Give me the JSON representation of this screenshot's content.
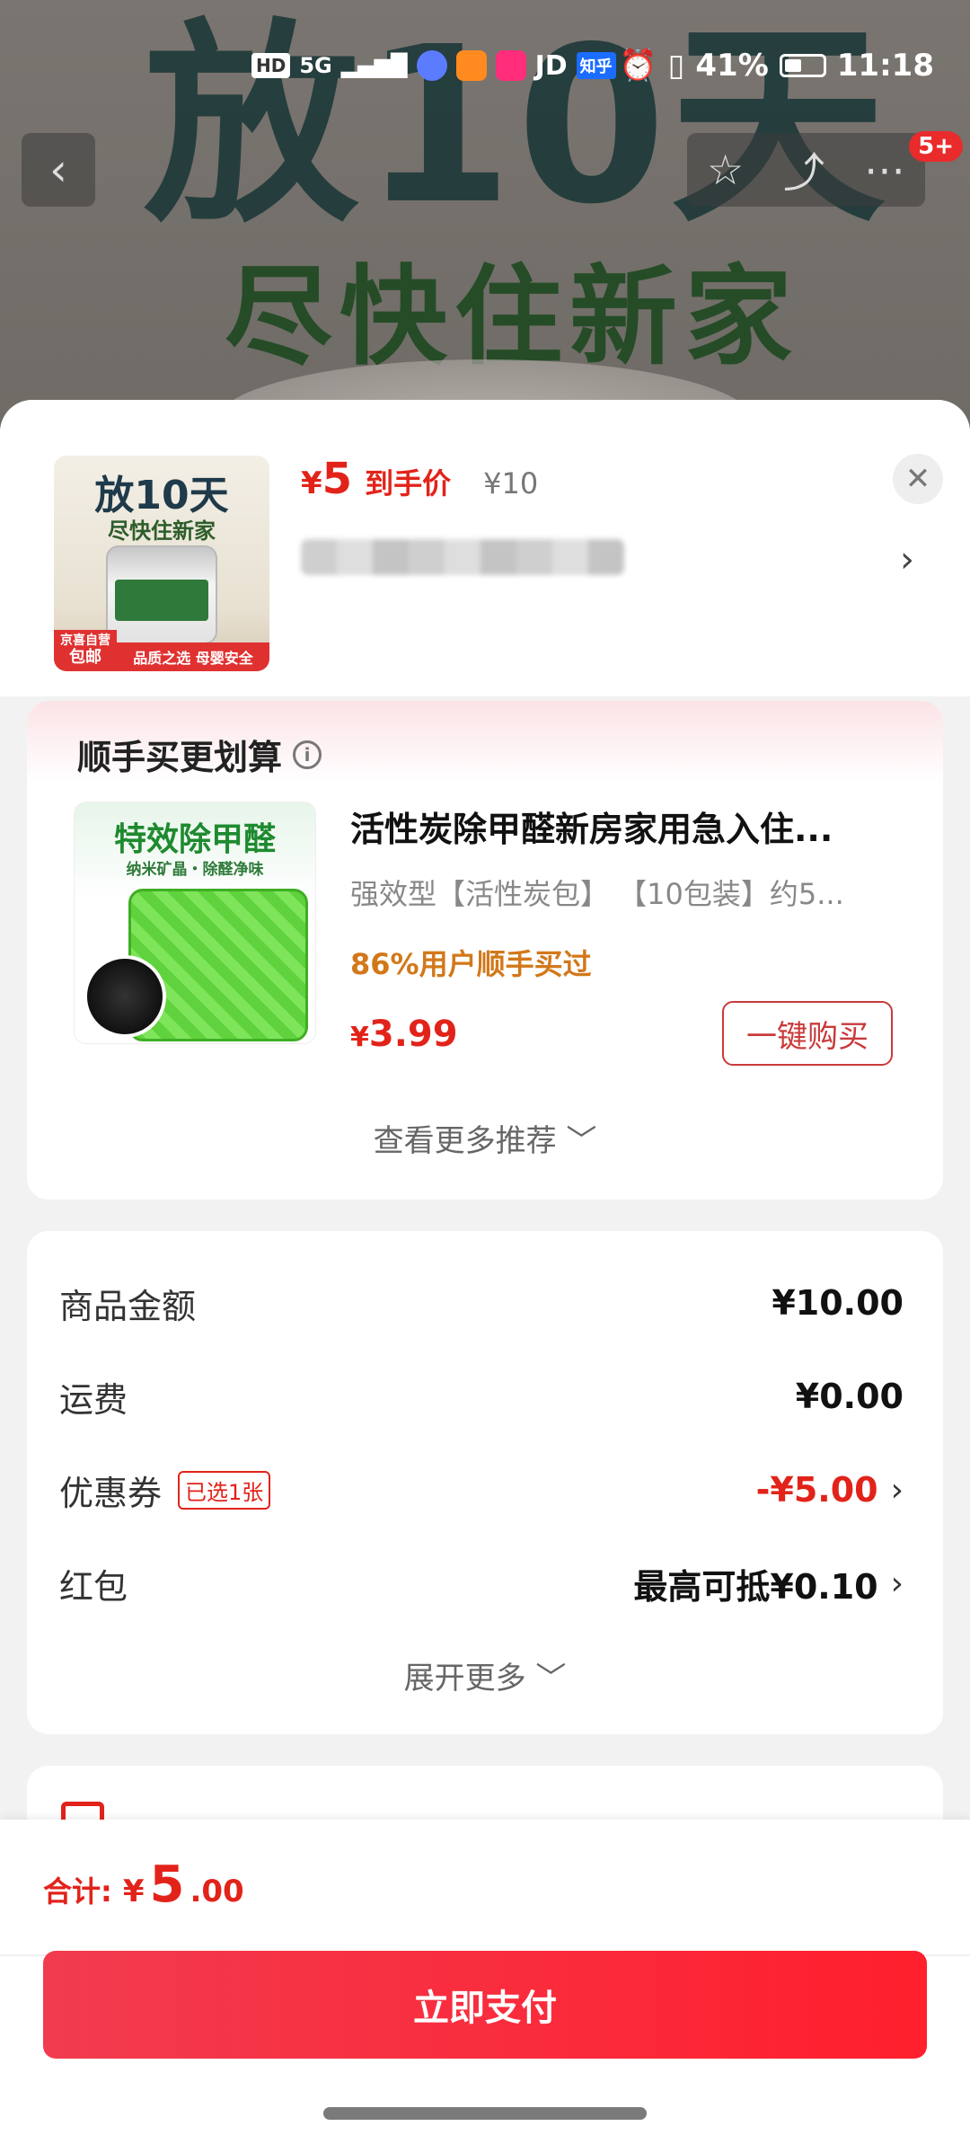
{
  "status_bar": {
    "network": "5G",
    "hd": "HD",
    "apps": [
      "JD",
      "知乎"
    ],
    "battery": "41%",
    "time": "11:18"
  },
  "background": {
    "headline": "放10天",
    "subline": "尽快住新家"
  },
  "nav": {
    "badge": "5+"
  },
  "product": {
    "thumb_title": "放10天",
    "thumb_sub": "尽快住新家",
    "thumb_tag_brand": "京喜自营",
    "thumb_tag_ship": "包邮",
    "thumb_tag_bottom": "品质之选 母婴安全",
    "price_yen": "¥",
    "price_value": "5",
    "price_label": "到手价",
    "price_old": "¥10"
  },
  "recommend": {
    "title": "顺手买更划算",
    "img_title": "特效除甲醛",
    "img_sub": "纳米矿晶・除醛净味",
    "name": "活性炭除甲醛新房家用急入住...",
    "spec": "强效型【活性炭包】 【10包装】约5...",
    "social": "86%用户顺手买过",
    "price_yen": "¥",
    "price_value": "3.99",
    "buy_label": "一键购买",
    "more_label": "查看更多推荐 ﹀"
  },
  "summary": {
    "rows": [
      {
        "label": "商品金额",
        "value": "¥10.00"
      },
      {
        "label": "运费",
        "value": "¥0.00"
      },
      {
        "label": "优惠券",
        "tag": "已选1张",
        "value": "-¥5.00"
      },
      {
        "label": "红包",
        "value": "最高可抵¥0.10"
      }
    ],
    "expand_label": "展开更多 ﹀"
  },
  "footer": {
    "total_label": "合计:",
    "total_yen": "¥",
    "total_int": "5",
    "total_dec": ".00",
    "pay_label": "立即支付"
  },
  "colors": {
    "accent_red": "#e2231a",
    "pay_button": "#ff1f2d",
    "social_orange": "#d2781a"
  }
}
